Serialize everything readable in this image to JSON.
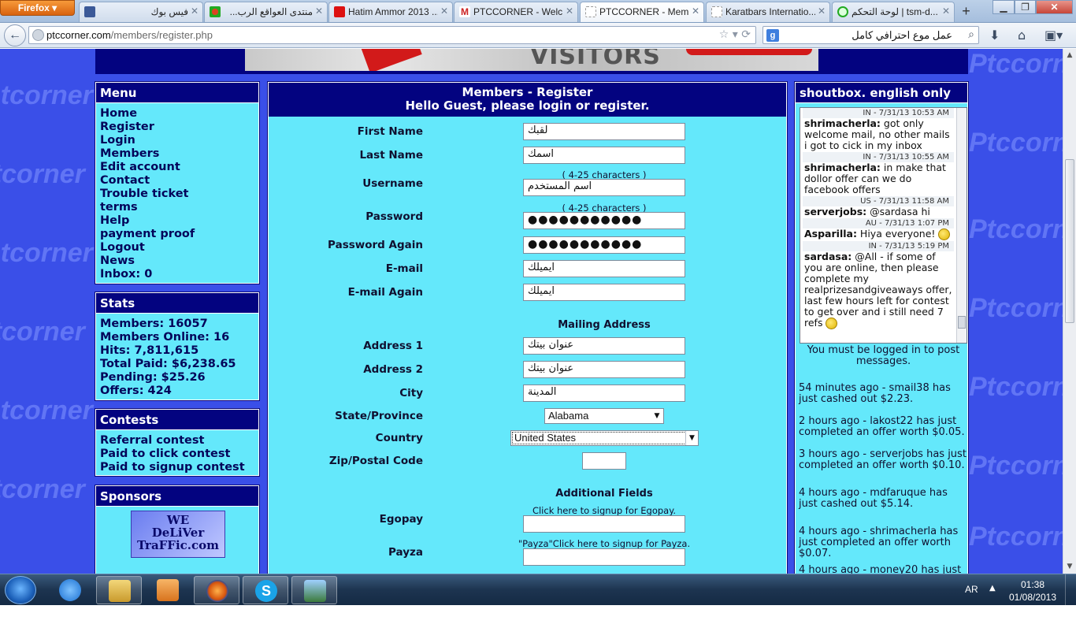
{
  "browser": {
    "app_button": "Firefox",
    "tabs": [
      {
        "label": "فيس بوك",
        "favicon": "facebook-icon",
        "active": false
      },
      {
        "label": "منتدى العواقع الرب...",
        "favicon": "forum-icon",
        "active": false
      },
      {
        "label": "Hatim Ammor 2013 ...",
        "favicon": "youtube-icon",
        "active": false
      },
      {
        "label": "PTCCORNER - Welc...",
        "favicon": "gmail-icon",
        "active": false
      },
      {
        "label": "PTCCORNER - Mem...",
        "favicon": "page-icon",
        "active": true
      },
      {
        "label": "Karatbars Internatio...",
        "favicon": "page-icon",
        "active": false
      },
      {
        "label": "لوحة التحكم | tsm-d...",
        "favicon": "green-circle-icon",
        "active": false
      }
    ],
    "new_tab": "+",
    "url_host": "ptccorner.com",
    "url_path": "/members/register.php",
    "search_engine": "g",
    "search_text": "عمل موع احترافي كامل"
  },
  "banner": {
    "text": "VISITORS"
  },
  "menu": {
    "title": "Menu",
    "items": [
      "Home",
      "Register",
      "Login",
      "Members",
      "Edit account",
      "Contact",
      "Trouble ticket",
      "terms",
      "Help",
      "payment proof",
      "Logout",
      "News",
      "Inbox: 0"
    ]
  },
  "stats": {
    "title": "Stats",
    "items": [
      "Members: 16057",
      "Members Online: 16",
      "Hits: 7,811,615",
      "Total Paid: $6,238.65",
      "Pending: $25.26",
      "Offers: 424"
    ]
  },
  "contests": {
    "title": "Contests",
    "items": [
      "Referral contest",
      "Paid to click contest",
      "Paid to signup contest"
    ]
  },
  "sponsors": {
    "title": "Sponsors",
    "logo_line1": "WE",
    "logo_line2": "DeLiVer",
    "logo_line3": "TraFFic.com"
  },
  "form": {
    "title": "Members - Register",
    "subtitle": "Hello Guest, please login or register.",
    "first_name_label": "First Name",
    "first_name_value": "لقبك",
    "last_name_label": "Last Name",
    "last_name_value": "اسمك",
    "username_hint": "( 4-25 characters )",
    "username_label": "Username",
    "username_value": "اسم المستخدم",
    "password_hint": "( 4-25 characters )",
    "password_label": "Password",
    "password_value": "●●●●●●●●●●●",
    "password_again_label": "Password Again",
    "password_again_value": "●●●●●●●●●●●",
    "email_label": "E-mail",
    "email_value": "ايميلك",
    "email_again_label": "E-mail Again",
    "email_again_value": "ايميلك",
    "mailing_heading": "Mailing Address",
    "address1_label": "Address 1",
    "address1_value": "عنوان بيتك",
    "address2_label": "Address 2",
    "address2_value": "عنوان بيتك",
    "city_label": "City",
    "city_value": "المدينة",
    "state_label": "State/Province",
    "state_value": "Alabama",
    "country_label": "Country",
    "country_value": "United States",
    "zip_label": "Zip/Postal Code",
    "zip_value": "",
    "additional_heading": "Additional Fields",
    "egopay_hint": "Click here to signup for Egopay.",
    "egopay_label": "Egopay",
    "payza_hint": "\"Payza\"Click here to signup for Payza.",
    "payza_label": "Payza"
  },
  "shoutbox": {
    "title": "shoutbox. english only",
    "messages": [
      {
        "meta": "IN - 7/31/13 10:53 AM",
        "user": "shrimacherla:",
        "text": " got only welcome mail, no other mails i got to cick in my inbox"
      },
      {
        "meta": "IN - 7/31/13 10:55 AM",
        "user": "shrimacherla:",
        "text": " in make that dollor offer can we do facebook offers"
      },
      {
        "meta": "US - 7/31/13 11:58 AM",
        "user": "serverjobs:",
        "text": " @sardasa hi"
      },
      {
        "meta": "AU - 7/31/13 1:07 PM",
        "user": "Asparilla:",
        "text": " Hiya everyone! "
      },
      {
        "meta": "IN - 7/31/13 5:19 PM",
        "user": "sardasa:",
        "text": " @All - if some of you are online, then please complete my realprizesandgiveaways offer, last few hours left for contest to get over and i still need 7 refs "
      }
    ],
    "login_note": "You must be logged in to post messages.",
    "feed": [
      "54 minutes ago - smail38 has just cashed out $2.23.",
      "2 hours ago - lakost22 has just completed an offer worth $0.05.",
      "3 hours ago - serverjobs has just completed an offer worth $0.10.",
      "4 hours ago - mdfaruque has just cashed out $5.14.",
      "4 hours ago - shrimacherla has just completed an offer worth $0.07.",
      "4 hours ago - money20 has just"
    ]
  },
  "taskbar": {
    "language": "AR",
    "time": "01:38",
    "date": "01/08/2013"
  },
  "colors": {
    "page_background": "#3a4fe8",
    "panel_header": "#030380",
    "panel_body": "#64e8fb"
  }
}
